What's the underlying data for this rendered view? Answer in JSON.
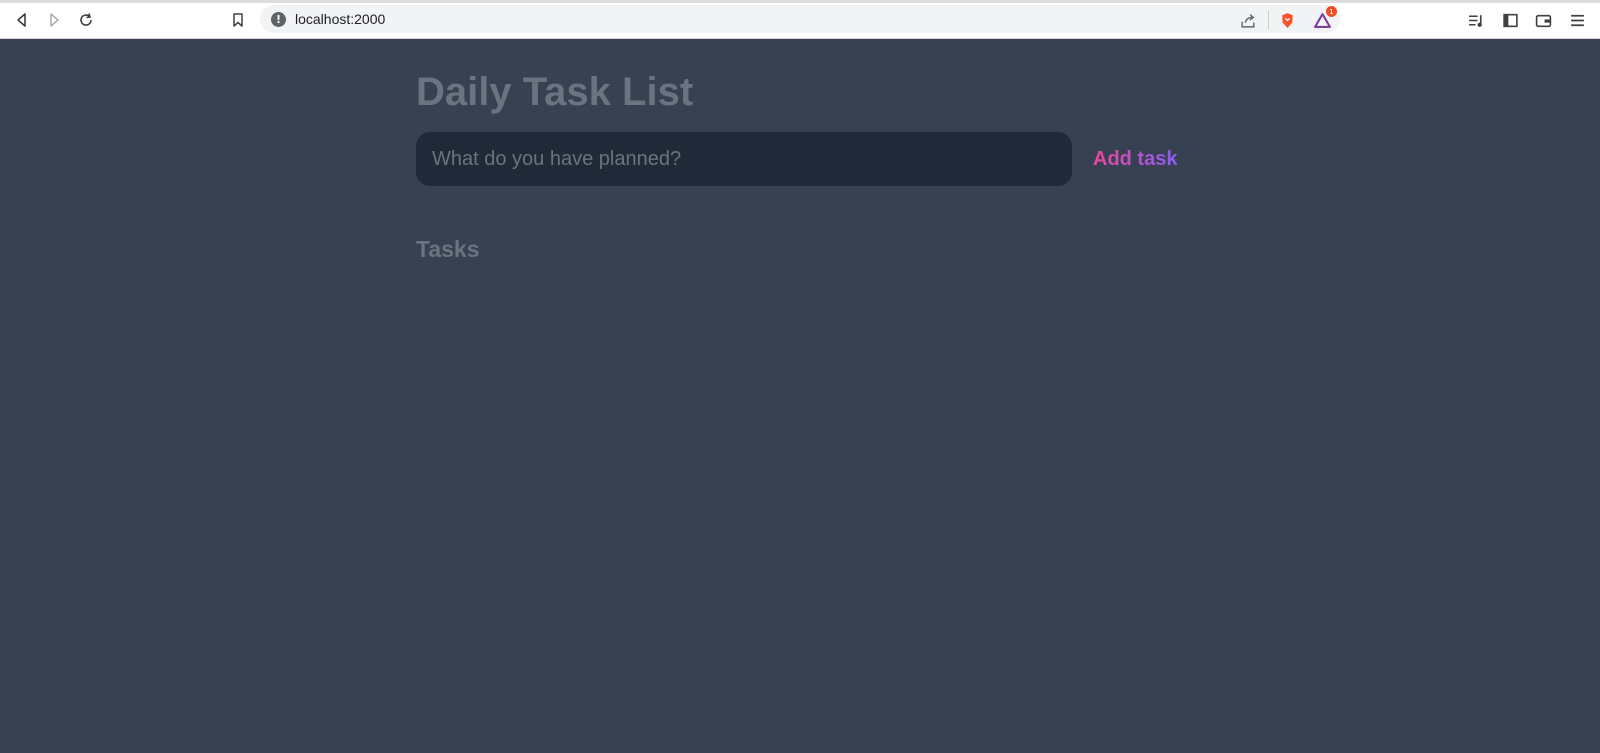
{
  "browser": {
    "url": "localhost:2000",
    "rewards_badge_count": "1",
    "icons": [
      "back-icon",
      "forward-icon",
      "reload-icon",
      "bookmark-icon",
      "site-info-icon",
      "share-icon",
      "brave-shields-icon",
      "brave-rewards-icon",
      "media-queue-icon",
      "sidebar-icon",
      "wallet-icon",
      "menu-icon"
    ]
  },
  "app": {
    "title": "Daily Task List",
    "input_placeholder": "What do you have planned?",
    "input_value": "",
    "add_button_label": "Add task",
    "tasks_heading": "Tasks",
    "tasks": [],
    "accent_gradient": [
      "#ec4899",
      "#8b5cf6"
    ],
    "background_color": "#374151",
    "input_background": "#1f2937",
    "muted_text_color": "#6b7280"
  }
}
